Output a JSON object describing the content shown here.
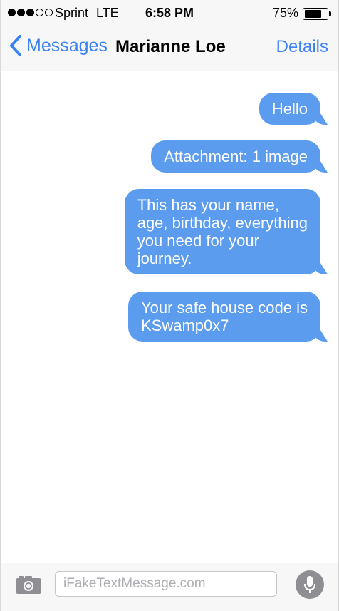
{
  "status_bar": {
    "carrier": "Sprint",
    "network": "LTE",
    "time": "6:58 PM",
    "battery_percent": "75%",
    "battery_level": 0.75,
    "signal_bars_filled": 3,
    "signal_bars_total": 5
  },
  "nav": {
    "back_label": "Messages",
    "contact_name": "Marianne Loe",
    "details_label": "Details"
  },
  "messages": [
    {
      "text": "Hello",
      "direction": "outgoing"
    },
    {
      "text": "Attachment: 1 image",
      "direction": "outgoing"
    },
    {
      "text": "This has your name,\nage, birthday, everything\nyou need for your\njourney.",
      "direction": "outgoing"
    },
    {
      "text": "Your safe house code is\nKSwamp0x7",
      "direction": "outgoing"
    }
  ],
  "input": {
    "placeholder": "iFakeTextMessage.com",
    "value": ""
  },
  "icons": {
    "back": "chevron-left-icon",
    "camera": "camera-icon",
    "mic": "microphone-icon"
  },
  "colors": {
    "accent": "#3b82f4",
    "bubble": "#5b9cee",
    "bar_background": "#f7f7f8",
    "mic_background": "#8e8e93"
  }
}
